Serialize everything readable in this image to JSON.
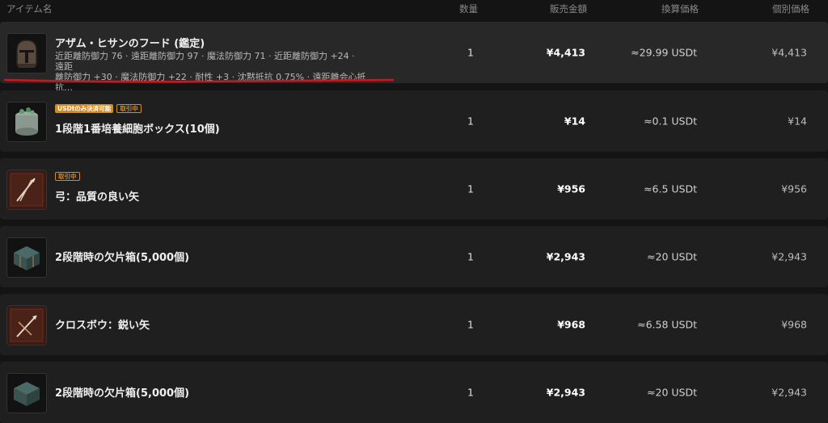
{
  "header": {
    "name": "アイテム名",
    "quantity": "数量",
    "price": "販売金額",
    "converted": "換算価格",
    "unit_price": "個別価格"
  },
  "rows": [
    {
      "title": "アザム・ヒサンのフード (鑑定)",
      "stats_line1": "近距離防御力 76 · 遠距離防御力 97 · 魔法防御力 71 · 近距離防御力 +24 · 遠距",
      "stats_line2": "離防御力 +30 · 魔法防御力 +22 · 耐性 +3 · 沈黙抵抗 0.75% · 遠距離会心抵抗…",
      "quantity": "1",
      "price": "¥4,413",
      "converted": "≈29.99 USDt",
      "unit_price": "¥4,413",
      "icon": "helmet-icon"
    },
    {
      "badge_usdt": "USDtのみ決済可能",
      "badge_trading": "取引中",
      "title": "1段階1番培養細胞ボックス(10個)",
      "quantity": "1",
      "price": "¥14",
      "converted": "≈0.1 USDt",
      "unit_price": "¥14",
      "icon": "cell-box-icon"
    },
    {
      "badge_trading": "取引中",
      "title": "弓：品質の良い矢",
      "quantity": "1",
      "price": "¥956",
      "converted": "≈6.5 USDt",
      "unit_price": "¥956",
      "icon": "arrow-bundle-icon"
    },
    {
      "title": "2段階時の欠片箱(5,000個)",
      "quantity": "1",
      "price": "¥2,943",
      "converted": "≈20 USDt",
      "unit_price": "¥2,943",
      "icon": "chest-icon"
    },
    {
      "title": "クロスボウ：鋭い矢",
      "quantity": "1",
      "price": "¥968",
      "converted": "≈6.58 USDt",
      "unit_price": "¥968",
      "icon": "bolt-bundle-icon"
    },
    {
      "title": "2段階時の欠片箱(5,000個)",
      "quantity": "1",
      "price": "¥2,943",
      "converted": "≈20 USDt",
      "unit_price": "¥2,943",
      "icon": "chest-icon"
    }
  ],
  "colors": {
    "background": "#141414",
    "row": "#1f1f1f",
    "row_highlight": "#282828",
    "badge_accent": "#d88a1c",
    "annotation_underline": "#d4141c"
  }
}
